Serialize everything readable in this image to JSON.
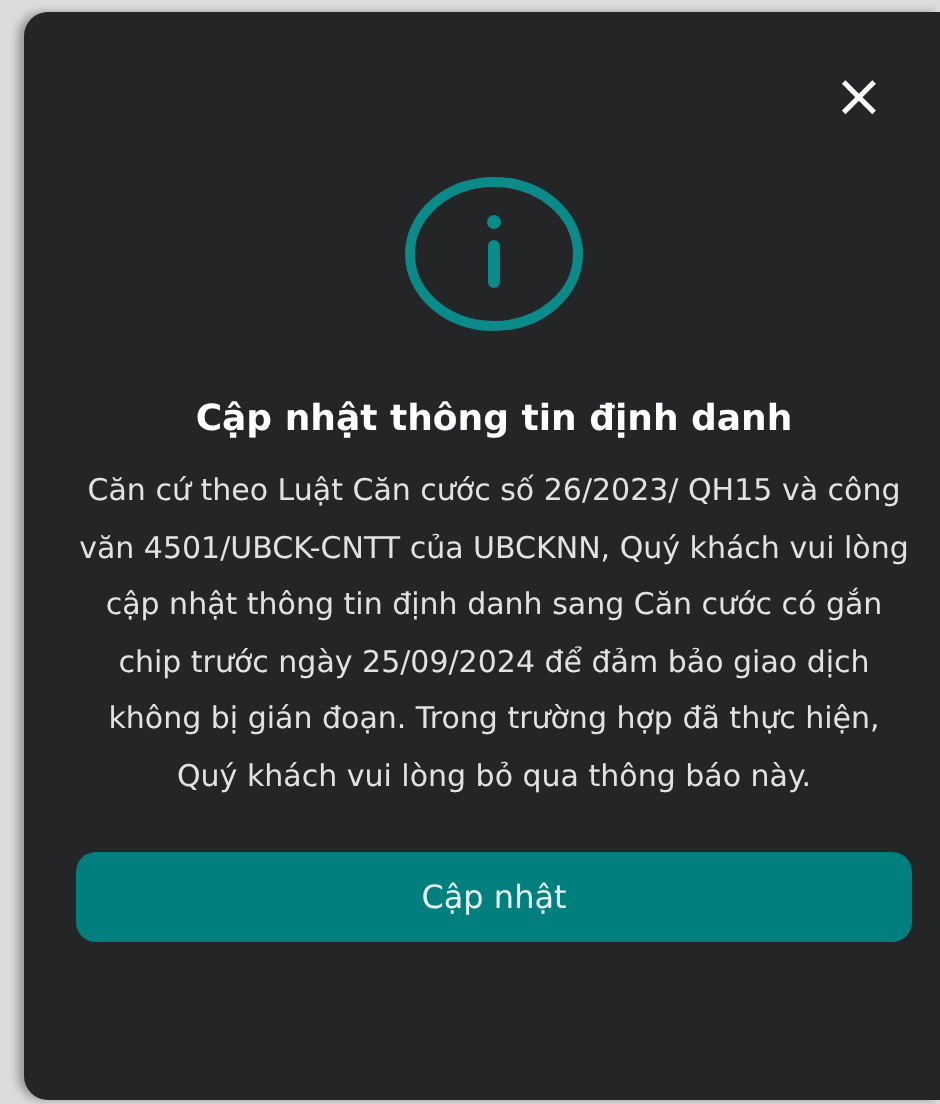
{
  "dialog": {
    "close": "×",
    "title": "Cập nhật thông tin định danh",
    "message": "Căn cứ theo Luật Căn cước số 26/2023/ QH15 và công văn 4501/UBCK-CNTT của UBCKNN, Quý khách vui lòng cập nhật thông tin định danh sang Căn cước có gắn chip trước ngày 25/09/2024 để đảm bảo giao dịch không bị gián đoạn. Trong trường hợp đã thực hiện, Quý khách vui lòng bỏ qua thông báo này.",
    "button": "Cập nhật"
  }
}
